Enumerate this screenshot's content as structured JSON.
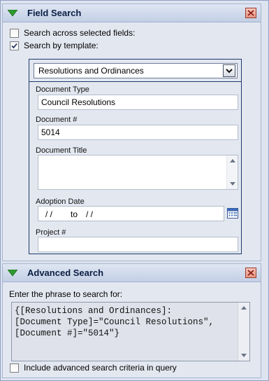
{
  "field_search": {
    "title": "Field Search",
    "across_label": "Search across selected fields:",
    "across_checked": false,
    "template_label": "Search by template:",
    "template_checked": true,
    "template_select": "Resolutions and Ordinances",
    "fields": {
      "document_type_label": "Document Type",
      "document_type_value": "Council Resolutions",
      "document_num_label": "Document #",
      "document_num_value": "5014",
      "document_title_label": "Document Title",
      "document_title_value": "",
      "adoption_date_label": "Adoption Date",
      "adoption_from": "/ /",
      "adoption_to_label": "to",
      "adoption_to": "/ /",
      "project_label": "Project #",
      "project_value": ""
    }
  },
  "advanced_search": {
    "title": "Advanced Search",
    "prompt": "Enter the phrase to search for:",
    "query": "{[Resolutions and Ordinances]:\n[Document Type]=\"Council Resolutions\",\n[Document #]=\"5014\"}",
    "include_label": "Include advanced search criteria in query",
    "include_checked": false
  },
  "colors": {
    "header_text": "#0b1f44",
    "collapse_green": "#2e9a2e",
    "close_red": "#c0392b",
    "panel_bg": "#e3e7f0"
  },
  "icons": [
    "collapse-arrow-icon",
    "close-icon",
    "check-icon",
    "chevron-down-icon",
    "calendar-icon",
    "scroll-up-icon",
    "scroll-down-icon"
  ]
}
